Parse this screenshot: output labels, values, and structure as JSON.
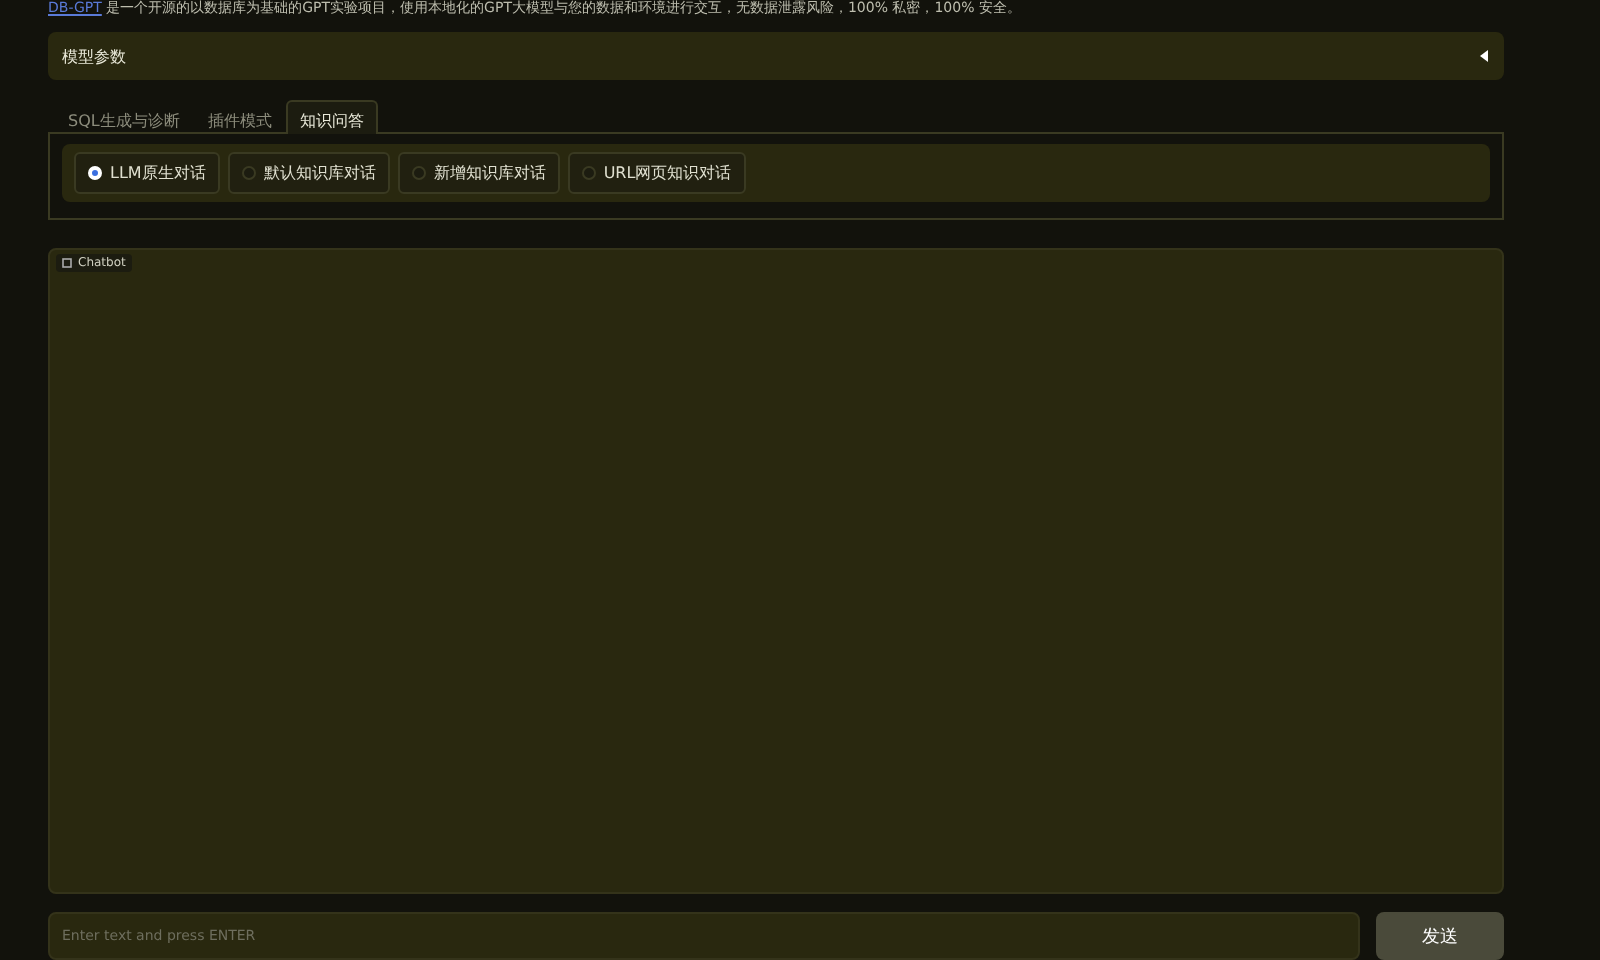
{
  "intro": {
    "link": "DB-GPT",
    "text": " 是一个开源的以数据库为基础的GPT实验项目，使用本地化的GPT大模型与您的数据和环境进行交互，无数据泄露风险，100% 私密，100% 安全。"
  },
  "accordion": {
    "title": "模型参数",
    "expanded": false
  },
  "tabs": [
    {
      "label": "SQL生成与诊断",
      "selected": false
    },
    {
      "label": "插件模式",
      "selected": false
    },
    {
      "label": "知识问答",
      "selected": true
    }
  ],
  "modes": [
    {
      "label": "LLM原生对话",
      "selected": true
    },
    {
      "label": "默认知识库对话",
      "selected": false
    },
    {
      "label": "新增知识库对话",
      "selected": false
    },
    {
      "label": "URL网页知识对话",
      "selected": false
    }
  ],
  "chatbot": {
    "label": "Chatbot"
  },
  "input": {
    "placeholder": "Enter text and press ENTER"
  },
  "send_button": "发送"
}
